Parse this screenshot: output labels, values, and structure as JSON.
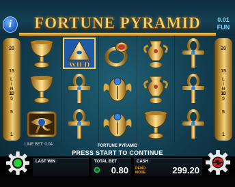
{
  "header": {
    "title": "FORTUNE PYRAMID",
    "info_label": "i",
    "denomination": "0.01",
    "currency": "FUN"
  },
  "rails": {
    "left": {
      "numbers": [
        "20",
        "15",
        "10",
        "5",
        "1"
      ],
      "label": [
        "L",
        "I",
        "N",
        "E",
        "S"
      ]
    },
    "right": {
      "numbers": [
        "20",
        "15",
        "10",
        "5",
        "1"
      ],
      "label": [
        "L",
        "I",
        "N",
        "E",
        "S"
      ]
    }
  },
  "reels": {
    "columns": 5,
    "rows": 3,
    "symbols": [
      [
        "goblet",
        "wild-pyramid",
        "ring",
        "golden-vase",
        "ankh"
      ],
      [
        "goblet",
        "ankh",
        "scarab",
        "golden-vase",
        "ankh"
      ],
      [
        "eye-of-horus",
        "ankh",
        "scarab",
        "goblet",
        "ankh"
      ]
    ],
    "wild_label": "WILD"
  },
  "message": {
    "line_bet_label": "LINE BET: 0.04",
    "title": "FORTUNE PYRAMID",
    "main": "PRESS START TO CONTINUE"
  },
  "bottom": {
    "last_win_label": "LAST WIN",
    "last_win_value": "",
    "total_bet_label": "TOTAL BET",
    "total_bet_value": "0.80",
    "cash_label": "CASH",
    "cash_value": "299.20",
    "mode_label_1": "DEMO",
    "mode_label_2": "MODE"
  },
  "colors": {
    "gold": "#f6d36a",
    "accent_blue": "#7fd6ff",
    "demo_orange": "#f39c12",
    "background": "#123c4e"
  }
}
